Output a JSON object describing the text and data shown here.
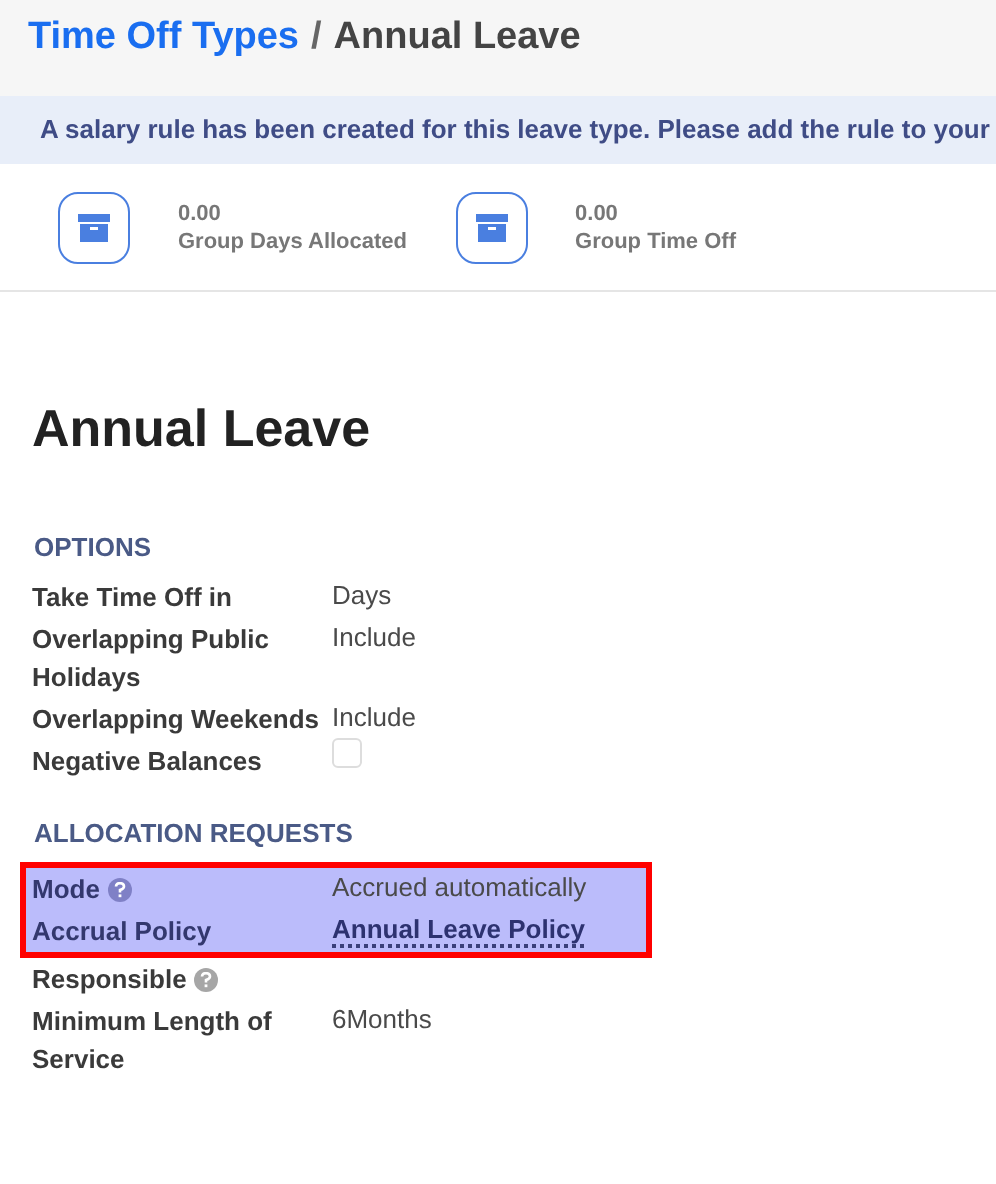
{
  "breadcrumb": {
    "parent": "Time Off Types",
    "separator": "/",
    "current": "Annual Leave"
  },
  "banner": "A salary rule has been created for this leave type. Please add the rule to your",
  "stats": [
    {
      "value": "0.00",
      "label": "Group Days Allocated"
    },
    {
      "value": "0.00",
      "label": "Group Time Off"
    }
  ],
  "title": "Annual Leave",
  "sections": [
    {
      "heading": "OPTIONS",
      "fields": [
        {
          "label": "Take Time Off in",
          "kind": "text",
          "value": "Days",
          "help": false,
          "highlighted": false
        },
        {
          "label": "Overlapping Public Holidays",
          "kind": "text",
          "value": "Include",
          "help": false,
          "highlighted": false
        },
        {
          "label": "Overlapping Weekends",
          "kind": "text",
          "value": "Include",
          "help": false,
          "highlighted": false
        },
        {
          "label": "Negative Balances",
          "kind": "checkbox",
          "checked": false,
          "help": false,
          "highlighted": false
        }
      ]
    },
    {
      "heading": "ALLOCATION REQUESTS",
      "fields": [
        {
          "label": "Mode",
          "kind": "text",
          "value": "Accrued automatically",
          "help": true,
          "highlighted": true
        },
        {
          "label": "Accrual Policy",
          "kind": "link",
          "value": "Annual Leave Policy",
          "help": false,
          "highlighted": true
        },
        {
          "label": "Responsible",
          "kind": "text",
          "help": true,
          "highlighted": false
        },
        {
          "label": "Minimum Length of Service",
          "kind": "text",
          "value": "6Months",
          "help": false,
          "highlighted": false
        }
      ]
    }
  ]
}
